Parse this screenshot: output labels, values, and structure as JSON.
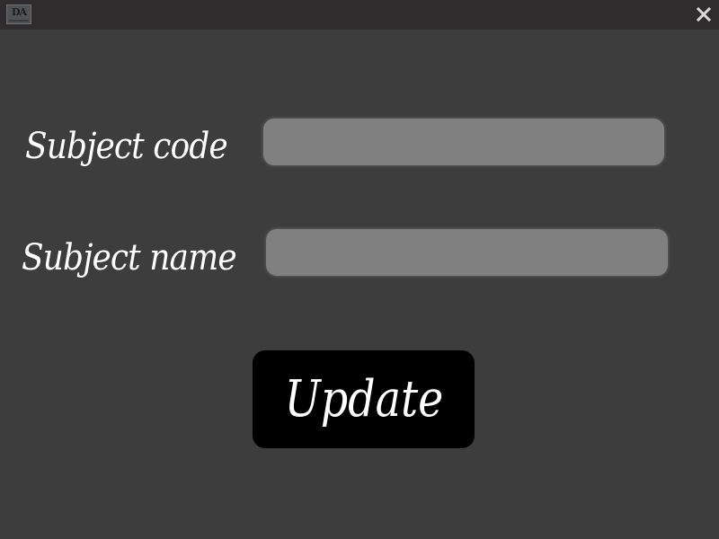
{
  "window": {
    "app_icon_text": "DA",
    "close_symbol": "x",
    "icons": [
      "app-logo-icon",
      "close-icon"
    ],
    "colors": {
      "background": "#3e3d3e",
      "titlebar": "#2e2c2d",
      "field": "#808080",
      "button": "#000000",
      "text": "#ffffff"
    }
  },
  "form": {
    "subject_code": {
      "label": "Subject code",
      "value": "",
      "placeholder": ""
    },
    "subject_name": {
      "label": "Subject name",
      "value": "",
      "placeholder": ""
    },
    "update_label": "Update"
  }
}
